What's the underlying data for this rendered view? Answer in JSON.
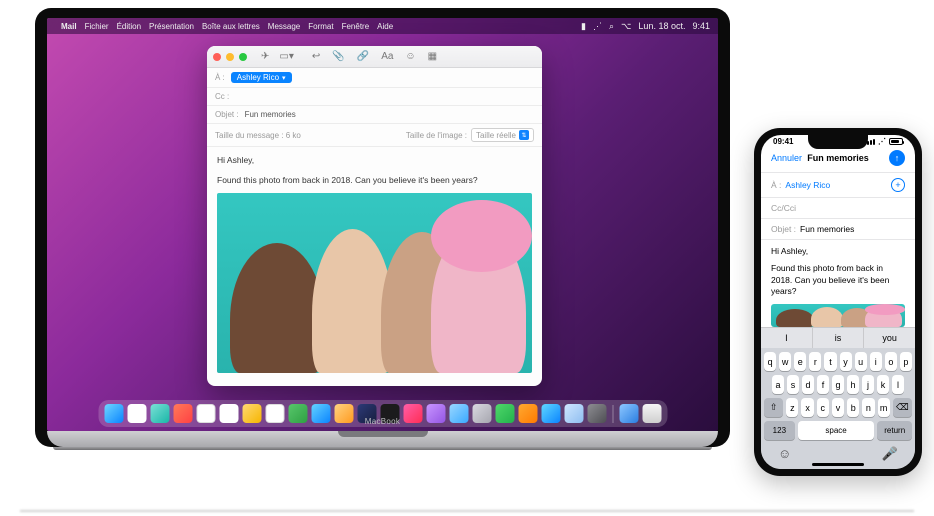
{
  "mac": {
    "menubar": {
      "app": "Mail",
      "items": [
        "Fichier",
        "Édition",
        "Présentation",
        "Boîte aux lettres",
        "Message",
        "Format",
        "Fenêtre",
        "Aide"
      ],
      "date": "Lun. 18 oct.",
      "time": "9:41"
    },
    "compose": {
      "to_label": "À :",
      "to_recipient": "Ashley Rico",
      "cc_label": "Cc :",
      "subject_label": "Objet :",
      "subject_value": "Fun memories",
      "size_label": "Taille du message :",
      "size_value": "6 ko",
      "image_size_label": "Taille de l'image :",
      "image_size_value": "Taille réelle",
      "body_greeting": "Hi Ashley,",
      "body_text": "Found this photo from back in 2018. Can you believe it's been years?"
    },
    "brand": "MacBook"
  },
  "iphone": {
    "status": {
      "time": "09:41"
    },
    "nav": {
      "cancel": "Annuler",
      "title": "Fun memories"
    },
    "to_label": "À :",
    "to_recipient": "Ashley Rico",
    "cc_label": "Cc/Cci",
    "subject_label": "Objet :",
    "subject_value": "Fun memories",
    "body_greeting": "Hi Ashley,",
    "body_text": "Found this photo from back in 2018. Can you believe it's been years?",
    "predictions": [
      "I",
      "is",
      "you"
    ],
    "keys_r1": [
      "q",
      "w",
      "e",
      "r",
      "t",
      "y",
      "u",
      "i",
      "o",
      "p"
    ],
    "keys_r2": [
      "a",
      "s",
      "d",
      "f",
      "g",
      "h",
      "j",
      "k",
      "l"
    ],
    "keys_r3": [
      "z",
      "x",
      "c",
      "v",
      "b",
      "n",
      "m"
    ],
    "shift": "⇧",
    "backspace": "⌫",
    "numkey": "123",
    "space": "space",
    "return": "return",
    "emoji": "☺",
    "mic": "🎤"
  }
}
